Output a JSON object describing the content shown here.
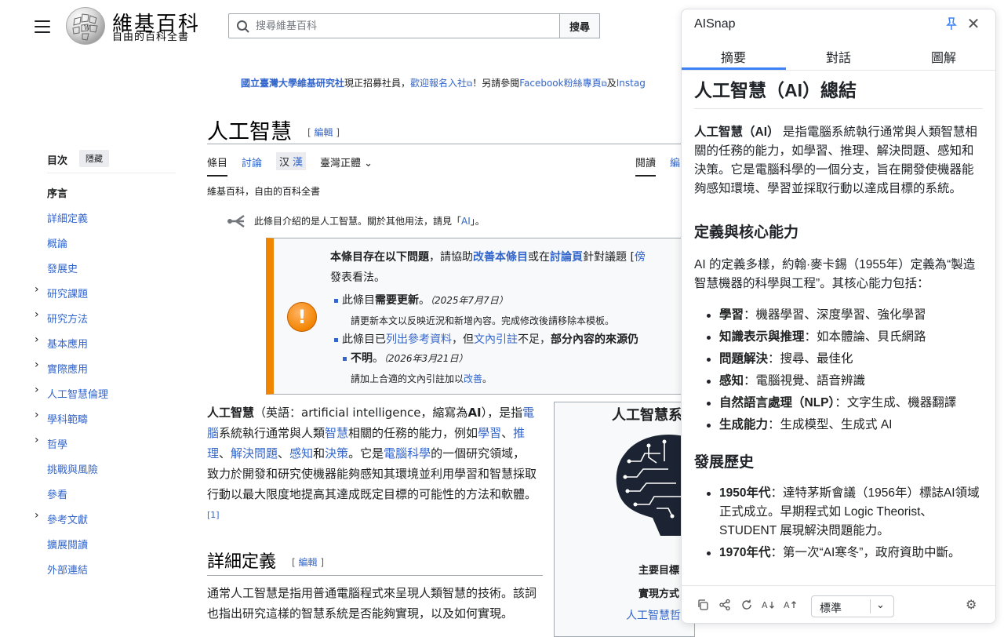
{
  "header": {
    "logo_title": "維基百科",
    "logo_tagline": "自由的百科全書",
    "search_placeholder": "搜尋維基百科",
    "search_button": "搜尋"
  },
  "banner": {
    "link1": "國立臺灣大學維基研究社",
    "text1": "現正招募社員，",
    "link2": "歡迎報名入社",
    "text2": "！另請參閱",
    "link3": "Facebook粉絲專頁",
    "text3": "及",
    "link4": "Instag"
  },
  "toc": {
    "heading": "目次",
    "hide_label": "隱藏",
    "items": [
      {
        "label": "序言",
        "expandable": false
      },
      {
        "label": "詳細定義",
        "expandable": false
      },
      {
        "label": "概論",
        "expandable": false
      },
      {
        "label": "發展史",
        "expandable": false
      },
      {
        "label": "研究課題",
        "expandable": true
      },
      {
        "label": "研究方法",
        "expandable": true
      },
      {
        "label": "基本應用",
        "expandable": true
      },
      {
        "label": "實際應用",
        "expandable": true
      },
      {
        "label": "人工智慧倫理",
        "expandable": true
      },
      {
        "label": "學科範疇",
        "expandable": true
      },
      {
        "label": "哲學",
        "expandable": true
      },
      {
        "label": "挑戰與風險",
        "expandable": false
      },
      {
        "label": "參看",
        "expandable": false
      },
      {
        "label": "參考文獻",
        "expandable": true
      },
      {
        "label": "擴展閱讀",
        "expandable": false
      },
      {
        "label": "外部連結",
        "expandable": false
      }
    ]
  },
  "article": {
    "title": "人工智慧",
    "title_edit": "編輯",
    "tabs": {
      "article": "條目",
      "talk": "討論",
      "lang_a": "汉",
      "lang_b": "漢",
      "variant": "臺灣正體",
      "read": "閱讀",
      "edit": "編"
    },
    "tagline": "維基百科，自由的百科全書",
    "hatnote": {
      "text": "此條目介紹的是人工智慧。關於其他用法，請見「",
      "link": "AI",
      "end": "」。"
    },
    "ambox": {
      "line1_a": "本條目存在以下問題",
      "line1_b": "，請協助",
      "line1_link1": "改善本條目",
      "line1_c": "或在",
      "line1_link2": "討論頁",
      "line1_d": "針對議題 [",
      "line1_link3": "傍",
      "line2": "發表看法。",
      "item1_a": "此條目",
      "item1_b": "需要更新",
      "item1_c": "。",
      "item1_date": "（2025年7月7日）",
      "item1_sub": "請更新本文以反映近況和新增內容。完成修改後請移除本模板。",
      "item2_a": "此條目已",
      "item2_link1": "列出參考資料",
      "item2_b": "，但",
      "item2_link2": "文內引註",
      "item2_c": "不足，",
      "item2_d": "部分內容的來源仍",
      "item2_e": "不明",
      "item2_f": "。",
      "item2_date": "（2026年3月21日）",
      "item2_sub_a": "請加上合適的文內引註加以",
      "item2_sub_link": "改善",
      "item2_sub_b": "。"
    },
    "lead": {
      "bold": "人工智慧",
      "t1": "（英語：artificial intelligence，縮寫為",
      "bold2": "AI",
      "t2": "），是指",
      "l1": "電腦",
      "t3": "系統執行通常與人類",
      "l2": "智慧",
      "t4": "相關的任務的能力，例如",
      "l3": "學習",
      "t5": "、",
      "l4": "推理",
      "t6": "、",
      "l5": "解決問題",
      "t7": "、",
      "l6": "感知",
      "t8": "和",
      "l7": "決策",
      "t9": "。它是",
      "l8": "電腦科學",
      "t10": "的一個研究領域，致力於開發和研究使機器能夠感知其環境並利用學習和智慧採取行動以最大限度地提高其達成既定目標的可能性的方法和軟體。",
      "ref": "[1]"
    },
    "h2_def": "詳細定義",
    "h2_def_edit": "編輯",
    "def_text": "通常人工智慧是指用普通電腦程式來呈現人類智慧的技術。該詞也指出研究這樣的智慧系統是否能夠實現，以及如何實現。"
  },
  "infobox": {
    "title": "人工智慧系",
    "row1": "主要目標",
    "row2": "實現方式",
    "row3": "人工智慧哲"
  },
  "panel": {
    "title": "AISnap",
    "tabs": [
      "摘要",
      "對話",
      "圖解"
    ],
    "h1": "人工智慧（AI）總結",
    "p1_bold": "人工智慧（AI）",
    "p1": " 是指電腦系統執行通常與人類智慧相關的任務的能力，如學習、推理、解決問題、感知和決策。它是電腦科學的一個分支，旨在開發使機器能夠感知環境、學習並採取行動以達成目標的系統。",
    "h2a": "定義與核心能力",
    "p2": "AI 的定義多樣，約翰·麥卡錫（1955年）定義為“製造智慧機器的科學與工程”。其核心能力包括：",
    "caps": [
      {
        "k": "學習",
        "v": "：機器學習、深度學習、強化學習"
      },
      {
        "k": "知識表示與推理",
        "v": "：如本體論、貝氏網路"
      },
      {
        "k": "問題解決",
        "v": "：搜尋、最佳化"
      },
      {
        "k": "感知",
        "v": "：電腦視覺、語音辨識"
      },
      {
        "k": "自然語言處理（NLP）",
        "v": "：文字生成、機器翻譯"
      },
      {
        "k": "生成能力",
        "v": "：生成模型、生成式 AI"
      }
    ],
    "h2b": "發展歷史",
    "hist": [
      {
        "k": "1950年代",
        "v": "：達特茅斯會議（1956年）標誌AI領域正式成立。早期程式如 Logic Theorist、STUDENT 展現解決問題能力。"
      },
      {
        "k": "1970年代",
        "v": "：第一次“AI寒冬”，政府資助中斷。"
      }
    ],
    "select_value": "標準"
  }
}
